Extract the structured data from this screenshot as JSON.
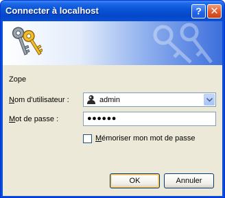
{
  "window": {
    "title": "Connecter à localhost",
    "help_glyph": "?",
    "close_glyph": "✕"
  },
  "dialog": {
    "realm": "Zope",
    "username_label_accel": "N",
    "username_label_rest": "om d'utilisateur :",
    "password_label_accel": "M",
    "password_label_rest": "ot de passe :",
    "username_value": "admin",
    "password_masked": "●●●●●●",
    "remember_accel": "M",
    "remember_rest": "émoriser mon mot de passe",
    "remember_checked": false,
    "ok_label": "OK",
    "cancel_label": "Annuler"
  },
  "icons": {
    "banner": "keys-icon",
    "watermark": "keys-watermark-icon",
    "user": "user-account-icon",
    "dropdown": "chevron-down-icon"
  },
  "colors": {
    "titlebar": "#0a55d8",
    "client_bg": "#ece9d8",
    "field_border": "#7f9db9",
    "default_button_highlight": "#f4bf5f"
  }
}
